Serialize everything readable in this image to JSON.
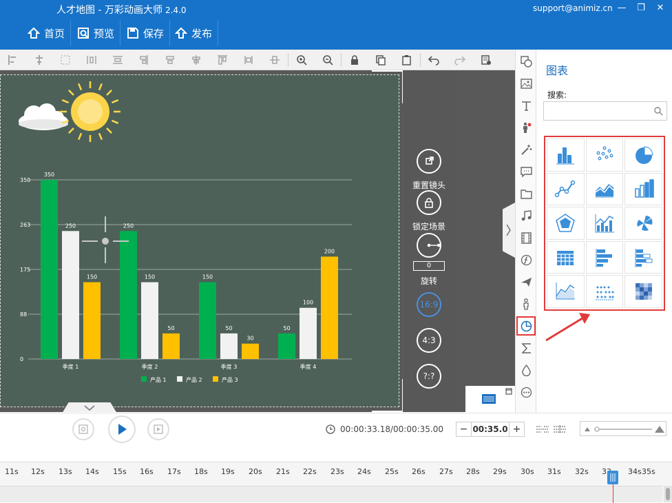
{
  "app": {
    "title": "人才地图 - 万彩动画大师",
    "version": "2.4.0",
    "email": "support@animiz.cn"
  },
  "window": {
    "minimize": "—",
    "restore": "❐",
    "close": "✕"
  },
  "main_toolbar": [
    {
      "label": "首页",
      "icon": "home-icon"
    },
    {
      "label": "预览",
      "icon": "preview-icon"
    },
    {
      "label": "保存",
      "icon": "save-icon"
    },
    {
      "label": "发布",
      "icon": "publish-icon"
    }
  ],
  "edit_toolbar": [
    "align-left-icon",
    "align-hcenter-icon",
    "group-icon",
    "distribute-icon",
    "align-row-icon",
    "align-col-icon",
    "align-center-icon",
    "align-top-icon",
    "align-middle-icon",
    "align-bottom-icon",
    "zoom-in-icon",
    "zoom-out-icon",
    "lock-icon",
    "copy-icon",
    "paste-icon",
    "undo-icon",
    "redo-icon",
    "settings-icon"
  ],
  "stage": {
    "background": "#4e6158"
  },
  "chart_data": {
    "type": "bar",
    "categories": [
      "季度 1",
      "季度 2",
      "季度 3",
      "季度 4"
    ],
    "series": [
      {
        "name": "产品 1",
        "values": [
          350,
          250,
          150,
          50
        ],
        "color": "#00b050"
      },
      {
        "name": "产品 2",
        "values": [
          250,
          150,
          50,
          100
        ],
        "color": "#f2f2f2"
      },
      {
        "name": "产品 3",
        "values": [
          150,
          50,
          30,
          200
        ],
        "color": "#ffc000"
      }
    ],
    "yticks": [
      "0",
      "88",
      "175",
      "263",
      "350"
    ],
    "ylim": [
      0,
      350
    ],
    "grid": true,
    "legend": "bottom"
  },
  "side_controls": {
    "reset_camera": "重置镜头",
    "lock_scene": "锁定场景",
    "rotate_value": "0",
    "rotate": "旋转",
    "ratio_169": "16:9",
    "ratio_43": "4:3",
    "ratio_custom": "?:?"
  },
  "icon_column": [
    "shape-icon",
    "image-icon",
    "text-icon",
    "role-icon",
    "magic-icon",
    "bubble-icon",
    "folder-icon",
    "music-icon",
    "video-icon",
    "formula-icon",
    "plane-icon",
    "person-icon",
    "chart-icon",
    "sigma-icon",
    "drop-icon",
    "more-icon"
  ],
  "right_panel": {
    "title": "图表",
    "search_label": "搜索:",
    "search_value": "",
    "chart_types": [
      "bar-chart-icon",
      "scatter-chart-icon",
      "pie-chart-icon",
      "line-chart-icon",
      "area-chart-icon",
      "column-chart-icon",
      "radar-chart-icon",
      "bar-line-chart-icon",
      "rose-chart-icon",
      "table-chart-icon",
      "horizontal-bar-icon",
      "stacked-bar-icon",
      "line-area-icon",
      "dot-matrix-icon",
      "heatmap-icon"
    ]
  },
  "playback": {
    "time": "00:00:33.18/00:00:35.00",
    "duration": "00:35.0",
    "minus": "−",
    "plus": "+"
  },
  "timeline": {
    "ticks": [
      "11s",
      "12s",
      "13s",
      "14s",
      "15s",
      "16s",
      "17s",
      "18s",
      "19s",
      "20s",
      "21s",
      "22s",
      "23s",
      "24s",
      "25s",
      "26s",
      "27s",
      "28s",
      "29s",
      "30s",
      "31s",
      "32s",
      "33",
      "34s",
      "35s"
    ]
  }
}
